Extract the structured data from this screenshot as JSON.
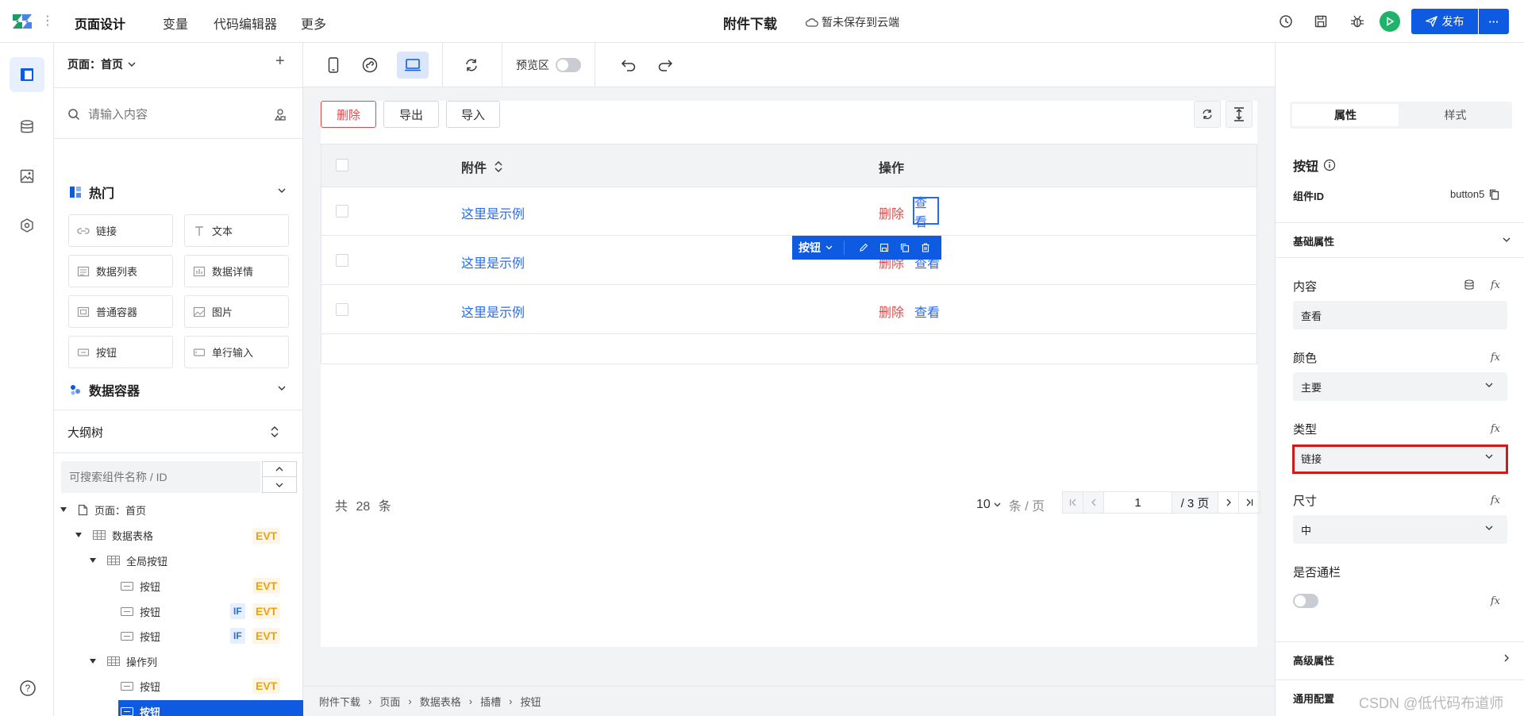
{
  "header": {
    "nav": [
      "页面设计",
      "变量",
      "代码编辑器",
      "更多"
    ],
    "page_title": "附件下载",
    "save_status": "暂未保存到云端",
    "publish_label": "发布",
    "more_label": "···"
  },
  "left_panel": {
    "page_select": "页面：首页",
    "add_icon": "+",
    "search_placeholder": "请输入内容",
    "hot_title": "热门",
    "components": [
      {
        "label": "链接",
        "icon": "link-icon"
      },
      {
        "label": "文本",
        "icon": "text-icon"
      },
      {
        "label": "数据列表",
        "icon": "data-list-icon"
      },
      {
        "label": "数据详情",
        "icon": "data-detail-icon"
      },
      {
        "label": "普通容器",
        "icon": "container-icon"
      },
      {
        "label": "图片",
        "icon": "image-icon"
      },
      {
        "label": "按钮",
        "icon": "button-icon"
      },
      {
        "label": "单行输入",
        "icon": "input-icon"
      }
    ],
    "data_container_title": "数据容器",
    "outline_title": "大纲树",
    "outline_search_placeholder": "可搜索组件名称 / ID",
    "tree": [
      {
        "label": "页面：首页",
        "level": 0,
        "evt": "",
        "if": ""
      },
      {
        "label": "数据表格",
        "level": 1,
        "evt": "EVT",
        "if": ""
      },
      {
        "label": "全局按钮",
        "level": 2,
        "evt": "",
        "if": ""
      },
      {
        "label": "按钮",
        "level": 3,
        "evt": "EVT",
        "if": ""
      },
      {
        "label": "按钮",
        "level": 3,
        "evt": "EVT",
        "if": "IF"
      },
      {
        "label": "按钮",
        "level": 3,
        "evt": "EVT",
        "if": "IF"
      },
      {
        "label": "操作列",
        "level": 2,
        "evt": "",
        "if": ""
      },
      {
        "label": "按钮",
        "level": 3,
        "evt": "EVT",
        "if": ""
      },
      {
        "label": "按钮",
        "level": 3,
        "evt": "",
        "if": "",
        "selected": true
      }
    ]
  },
  "toolbar": {
    "preview_label": "预览区"
  },
  "canvas": {
    "actions": [
      "删除",
      "导出",
      "导入"
    ],
    "columns": [
      "附件",
      "操作"
    ],
    "rows": [
      {
        "name": "这里是示例",
        "del": "删除",
        "view": "查看"
      },
      {
        "name": "这里是示例",
        "del": "删除",
        "view": "查看"
      },
      {
        "name": "这里是示例",
        "del": "删除",
        "view": "查看"
      }
    ],
    "float_toolbar_label": "按钮",
    "total_prefix": "共",
    "total_count": "28",
    "total_suffix": "条",
    "page_size": "10",
    "page_size_unit": "条 / 页",
    "page_current": "1",
    "page_total": "/ 3 页"
  },
  "breadcrumbs": [
    "附件下载",
    "页面",
    "数据表格",
    "插槽",
    "按钮"
  ],
  "right_panel": {
    "tabs": [
      "属性",
      "样式"
    ],
    "component_title": "按钮",
    "component_id_label": "组件ID",
    "component_id_value": "button5",
    "basic_section": "基础属性",
    "content_label": "内容",
    "content_value": "查看",
    "color_label": "颜色",
    "color_value": "主要",
    "type_label": "类型",
    "type_value": "链接",
    "size_label": "尺寸",
    "size_value": "中",
    "block_label": "是否通栏",
    "advanced_section": "高级属性",
    "general_section": "通用配置",
    "fx": "fx"
  },
  "watermark": "CSDN @低代码布道师",
  "colors": {
    "primary": "#0e5ae0",
    "danger": "#e04a4a",
    "link": "#2a6ce6",
    "evt": "#f2a00b",
    "highlight_box": "#d11a1a"
  }
}
